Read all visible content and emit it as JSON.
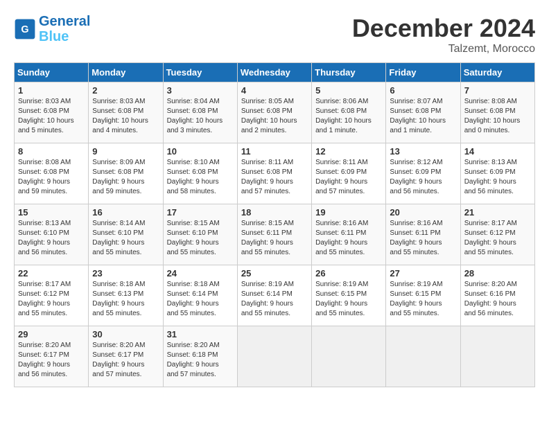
{
  "header": {
    "logo_line1": "General",
    "logo_line2": "Blue",
    "month": "December 2024",
    "location": "Talzemt, Morocco"
  },
  "days_of_week": [
    "Sunday",
    "Monday",
    "Tuesday",
    "Wednesday",
    "Thursday",
    "Friday",
    "Saturday"
  ],
  "weeks": [
    [
      {
        "day": "1",
        "info": "Sunrise: 8:03 AM\nSunset: 6:08 PM\nDaylight: 10 hours\nand 5 minutes."
      },
      {
        "day": "2",
        "info": "Sunrise: 8:03 AM\nSunset: 6:08 PM\nDaylight: 10 hours\nand 4 minutes."
      },
      {
        "day": "3",
        "info": "Sunrise: 8:04 AM\nSunset: 6:08 PM\nDaylight: 10 hours\nand 3 minutes."
      },
      {
        "day": "4",
        "info": "Sunrise: 8:05 AM\nSunset: 6:08 PM\nDaylight: 10 hours\nand 2 minutes."
      },
      {
        "day": "5",
        "info": "Sunrise: 8:06 AM\nSunset: 6:08 PM\nDaylight: 10 hours\nand 1 minute."
      },
      {
        "day": "6",
        "info": "Sunrise: 8:07 AM\nSunset: 6:08 PM\nDaylight: 10 hours\nand 1 minute."
      },
      {
        "day": "7",
        "info": "Sunrise: 8:08 AM\nSunset: 6:08 PM\nDaylight: 10 hours\nand 0 minutes."
      }
    ],
    [
      {
        "day": "8",
        "info": "Sunrise: 8:08 AM\nSunset: 6:08 PM\nDaylight: 9 hours\nand 59 minutes."
      },
      {
        "day": "9",
        "info": "Sunrise: 8:09 AM\nSunset: 6:08 PM\nDaylight: 9 hours\nand 59 minutes."
      },
      {
        "day": "10",
        "info": "Sunrise: 8:10 AM\nSunset: 6:08 PM\nDaylight: 9 hours\nand 58 minutes."
      },
      {
        "day": "11",
        "info": "Sunrise: 8:11 AM\nSunset: 6:08 PM\nDaylight: 9 hours\nand 57 minutes."
      },
      {
        "day": "12",
        "info": "Sunrise: 8:11 AM\nSunset: 6:09 PM\nDaylight: 9 hours\nand 57 minutes."
      },
      {
        "day": "13",
        "info": "Sunrise: 8:12 AM\nSunset: 6:09 PM\nDaylight: 9 hours\nand 56 minutes."
      },
      {
        "day": "14",
        "info": "Sunrise: 8:13 AM\nSunset: 6:09 PM\nDaylight: 9 hours\nand 56 minutes."
      }
    ],
    [
      {
        "day": "15",
        "info": "Sunrise: 8:13 AM\nSunset: 6:10 PM\nDaylight: 9 hours\nand 56 minutes."
      },
      {
        "day": "16",
        "info": "Sunrise: 8:14 AM\nSunset: 6:10 PM\nDaylight: 9 hours\nand 55 minutes."
      },
      {
        "day": "17",
        "info": "Sunrise: 8:15 AM\nSunset: 6:10 PM\nDaylight: 9 hours\nand 55 minutes."
      },
      {
        "day": "18",
        "info": "Sunrise: 8:15 AM\nSunset: 6:11 PM\nDaylight: 9 hours\nand 55 minutes."
      },
      {
        "day": "19",
        "info": "Sunrise: 8:16 AM\nSunset: 6:11 PM\nDaylight: 9 hours\nand 55 minutes."
      },
      {
        "day": "20",
        "info": "Sunrise: 8:16 AM\nSunset: 6:11 PM\nDaylight: 9 hours\nand 55 minutes."
      },
      {
        "day": "21",
        "info": "Sunrise: 8:17 AM\nSunset: 6:12 PM\nDaylight: 9 hours\nand 55 minutes."
      }
    ],
    [
      {
        "day": "22",
        "info": "Sunrise: 8:17 AM\nSunset: 6:12 PM\nDaylight: 9 hours\nand 55 minutes."
      },
      {
        "day": "23",
        "info": "Sunrise: 8:18 AM\nSunset: 6:13 PM\nDaylight: 9 hours\nand 55 minutes."
      },
      {
        "day": "24",
        "info": "Sunrise: 8:18 AM\nSunset: 6:14 PM\nDaylight: 9 hours\nand 55 minutes."
      },
      {
        "day": "25",
        "info": "Sunrise: 8:19 AM\nSunset: 6:14 PM\nDaylight: 9 hours\nand 55 minutes."
      },
      {
        "day": "26",
        "info": "Sunrise: 8:19 AM\nSunset: 6:15 PM\nDaylight: 9 hours\nand 55 minutes."
      },
      {
        "day": "27",
        "info": "Sunrise: 8:19 AM\nSunset: 6:15 PM\nDaylight: 9 hours\nand 55 minutes."
      },
      {
        "day": "28",
        "info": "Sunrise: 8:20 AM\nSunset: 6:16 PM\nDaylight: 9 hours\nand 56 minutes."
      }
    ],
    [
      {
        "day": "29",
        "info": "Sunrise: 8:20 AM\nSunset: 6:17 PM\nDaylight: 9 hours\nand 56 minutes."
      },
      {
        "day": "30",
        "info": "Sunrise: 8:20 AM\nSunset: 6:17 PM\nDaylight: 9 hours\nand 57 minutes."
      },
      {
        "day": "31",
        "info": "Sunrise: 8:20 AM\nSunset: 6:18 PM\nDaylight: 9 hours\nand 57 minutes."
      },
      {
        "day": "",
        "info": ""
      },
      {
        "day": "",
        "info": ""
      },
      {
        "day": "",
        "info": ""
      },
      {
        "day": "",
        "info": ""
      }
    ]
  ]
}
